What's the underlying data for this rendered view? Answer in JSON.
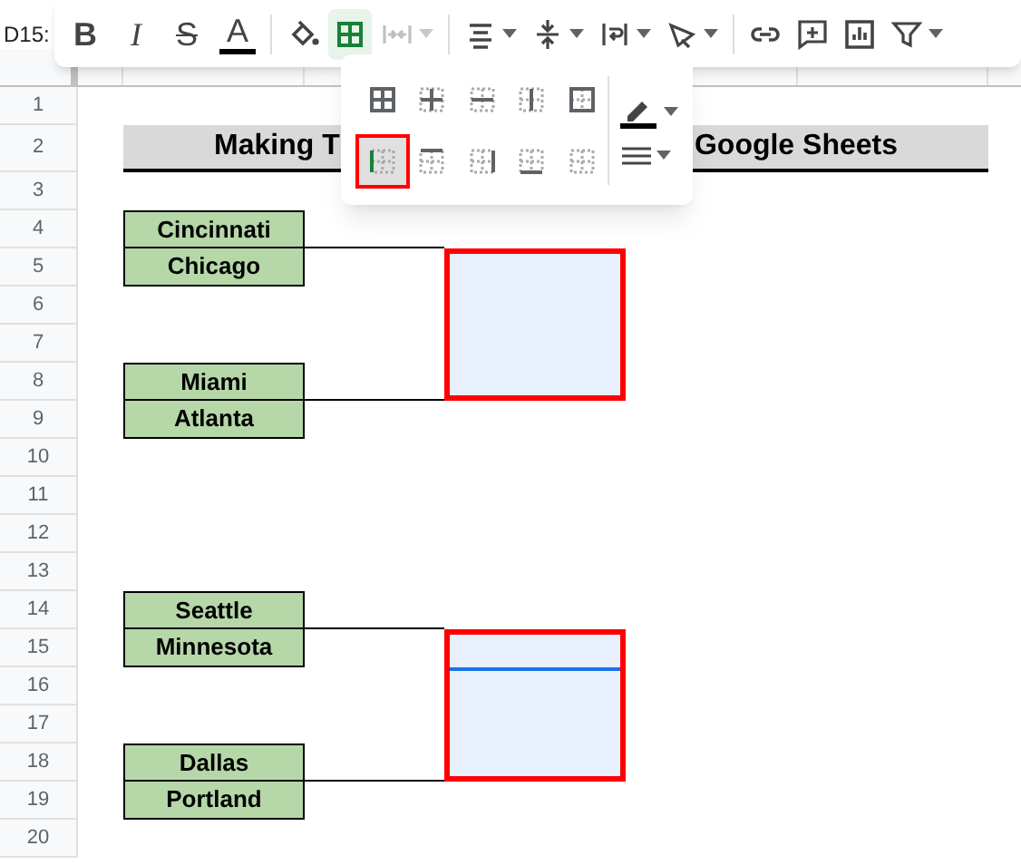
{
  "name_box": "D15:",
  "toolbar": [
    {
      "kind": "bold",
      "label": "B",
      "active": false,
      "disabled": false
    },
    {
      "kind": "italic",
      "label": "I",
      "active": false,
      "disabled": false
    },
    {
      "kind": "strike",
      "label": "S",
      "active": false,
      "disabled": false
    },
    {
      "kind": "text-color",
      "label": "A",
      "active": false,
      "disabled": false
    },
    {
      "kind": "divider"
    },
    {
      "kind": "fill",
      "active": false,
      "disabled": false
    },
    {
      "kind": "borders",
      "active": true,
      "disabled": false
    },
    {
      "kind": "merge",
      "active": false,
      "disabled": true,
      "caret": true
    },
    {
      "kind": "divider"
    },
    {
      "kind": "align",
      "active": false,
      "disabled": false,
      "caret": true
    },
    {
      "kind": "valign",
      "active": false,
      "disabled": false,
      "caret": true
    },
    {
      "kind": "wrap",
      "active": false,
      "disabled": false,
      "caret": true
    },
    {
      "kind": "rotate",
      "active": false,
      "disabled": false,
      "caret": true
    },
    {
      "kind": "divider"
    },
    {
      "kind": "link",
      "active": false,
      "disabled": false
    },
    {
      "kind": "comment",
      "active": false,
      "disabled": false
    },
    {
      "kind": "chart",
      "active": false,
      "disabled": false
    },
    {
      "kind": "filter",
      "active": false,
      "disabled": false,
      "caret": true
    }
  ],
  "rows": [
    "1",
    "2",
    "3",
    "4",
    "5",
    "6",
    "7",
    "8",
    "9",
    "10",
    "11",
    "12",
    "13",
    "14",
    "15",
    "16",
    "17",
    "18",
    "19",
    "20"
  ],
  "title": {
    "left": "Making T",
    "right": "Google Sheets"
  },
  "groups": [
    {
      "pairs": [
        [
          "Cincinnati",
          "Chicago"
        ],
        [
          "Miami",
          "Atlanta"
        ]
      ],
      "highlighted": true,
      "active_cell": false
    },
    {
      "pairs": [
        [
          "Seattle",
          "Minnesota"
        ],
        [
          "Dallas",
          "Portland"
        ]
      ],
      "highlighted": true,
      "active_cell": true
    }
  ],
  "border_menu": {
    "options": [
      {
        "kind": "all",
        "selected": false
      },
      {
        "kind": "inner",
        "selected": false
      },
      {
        "kind": "horizontal",
        "selected": false
      },
      {
        "kind": "vertical",
        "selected": false
      },
      {
        "kind": "outer",
        "selected": false
      },
      {
        "kind": "left",
        "selected": true
      },
      {
        "kind": "top",
        "selected": false
      },
      {
        "kind": "right",
        "selected": false
      },
      {
        "kind": "bottom",
        "selected": false
      },
      {
        "kind": "clear",
        "selected": false
      }
    ]
  }
}
